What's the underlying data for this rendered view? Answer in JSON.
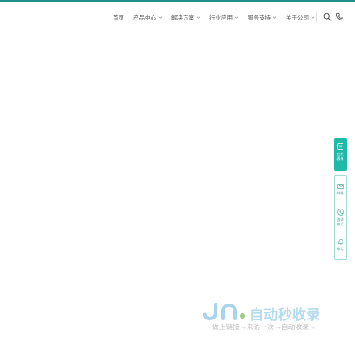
{
  "nav": {
    "items": [
      {
        "label": "首页",
        "has_dropdown": false
      },
      {
        "label": "产品中心",
        "has_dropdown": true
      },
      {
        "label": "解决方案",
        "has_dropdown": true
      },
      {
        "label": "行业应用",
        "has_dropdown": true
      },
      {
        "label": "服务支持",
        "has_dropdown": true
      },
      {
        "label": "关于公司",
        "has_dropdown": true
      }
    ],
    "icons": [
      "search-icon",
      "phone-icon"
    ]
  },
  "side_tools": {
    "primary": {
      "label": "在线表单",
      "icon": "form-icon"
    },
    "items": [
      {
        "label": "邮箱",
        "icon": "mail-icon"
      },
      {
        "label": "咨询电话",
        "icon": "phone-icon"
      },
      {
        "label": "电话",
        "icon": "bell-icon"
      }
    ]
  },
  "watermark": {
    "brand": "自动秒收录",
    "tagline": "做上链接→来访一次→自动收录→"
  },
  "colors": {
    "accent": "#1fb9a8",
    "top_stripe": "#1f8f8a",
    "nav_text": "#555555",
    "watermark_blue": "#a8d5ec",
    "watermark_green": "#9ccf7a"
  }
}
